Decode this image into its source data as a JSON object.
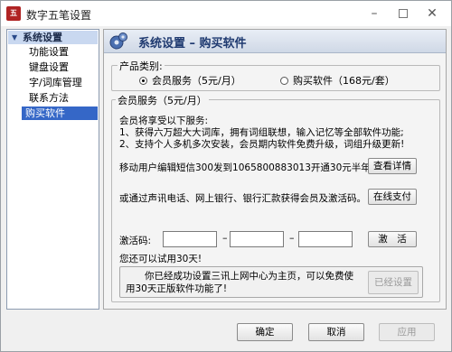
{
  "window": {
    "title": "数字五笔设置",
    "icon_name": "app-logo-icon"
  },
  "sidebar": {
    "root_label": "系统设置",
    "items": [
      {
        "label": "功能设置"
      },
      {
        "label": "键盘设置"
      },
      {
        "label": "字/词库管理"
      },
      {
        "label": "联系方法"
      },
      {
        "label": "购买软件",
        "selected": true
      }
    ]
  },
  "header": {
    "title": "系统设置 – 购买软件",
    "icon_name": "gears-icon"
  },
  "product": {
    "legend": "产品类别:",
    "options": [
      {
        "label": "会员服务（5元/月）",
        "selected": true
      },
      {
        "label": "购买软件（168元/套）",
        "selected": false
      }
    ]
  },
  "member": {
    "legend": "会员服务（5元/月）",
    "benefits_title": "会员将享受以下服务:",
    "benefit_1": "1、获得六万超大大词库，拥有词组联想，输入记忆等全部软件功能;",
    "benefit_2": "2、支持个人多机多次安装，会员期内软件免费升级，词组升级更新!",
    "sms_text": "移动用户编辑短信300发到1065800883013开通30元半年会员",
    "view_details_label": "查看详情",
    "alt_text": "或通过声讯电话、网上银行、银行汇款获得会员及激活码。",
    "pay_online_label": "在线支付",
    "activation_label": "激活码:",
    "activation_values": [
      "",
      "",
      ""
    ],
    "dash": "–",
    "activate_label": "激　活",
    "trial_text": "您还可以试用30天!",
    "promo_text": "　　你已经成功设置三讯上网中心为主页，可以免费使用30天正版软件功能了!",
    "already_set_label": "已经设置"
  },
  "footer": {
    "ok_label": "确定",
    "cancel_label": "取消",
    "apply_label": "应用"
  }
}
